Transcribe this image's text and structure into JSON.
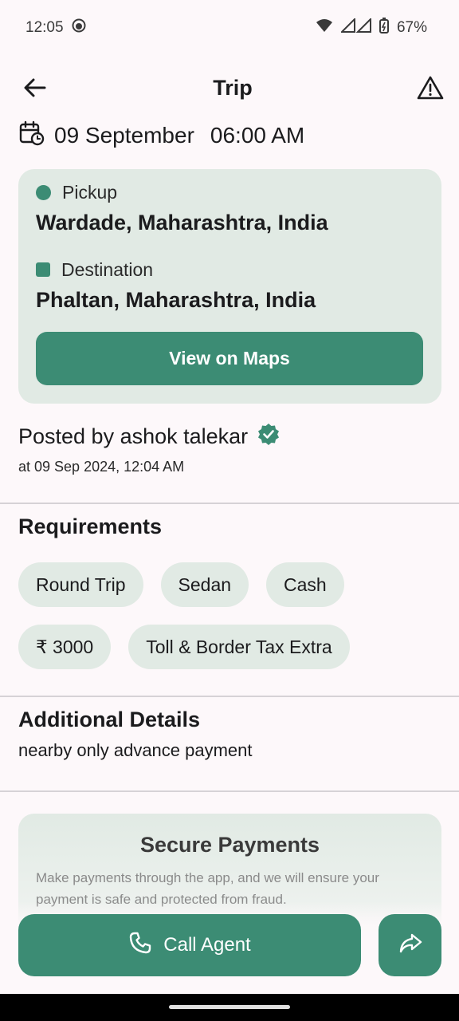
{
  "status_bar": {
    "time": "12:05",
    "battery": "67%"
  },
  "app_bar": {
    "title": "Trip"
  },
  "trip": {
    "date": "09 September",
    "time": "06:00 AM"
  },
  "route": {
    "pickup_label": "Pickup",
    "pickup_place": "Wardade, Maharashtra, India",
    "destination_label": "Destination",
    "destination_place": "Phaltan, Maharashtra, India",
    "maps_button": "View on Maps"
  },
  "posted": {
    "by": "Posted by ashok talekar",
    "at": "at 09 Sep 2024, 12:04 AM"
  },
  "requirements": {
    "title": "Requirements",
    "chips": [
      "Round Trip",
      "Sedan",
      "Cash",
      "₹ 3000",
      "Toll & Border Tax Extra"
    ]
  },
  "additional": {
    "title": "Additional Details",
    "text": "nearby only advance payment"
  },
  "secure": {
    "title": "Secure Payments",
    "text": "Make payments through the app, and we will ensure your payment is safe and protected from fraud."
  },
  "actions": {
    "call_label": "Call Agent"
  },
  "colors": {
    "accent": "#3c8c74",
    "card": "#e1eae4",
    "background": "#fdf8fa"
  },
  "icons": [
    "back-arrow-icon",
    "warning-icon",
    "calendar-clock-icon",
    "verified-badge-icon",
    "phone-icon",
    "share-icon"
  ]
}
